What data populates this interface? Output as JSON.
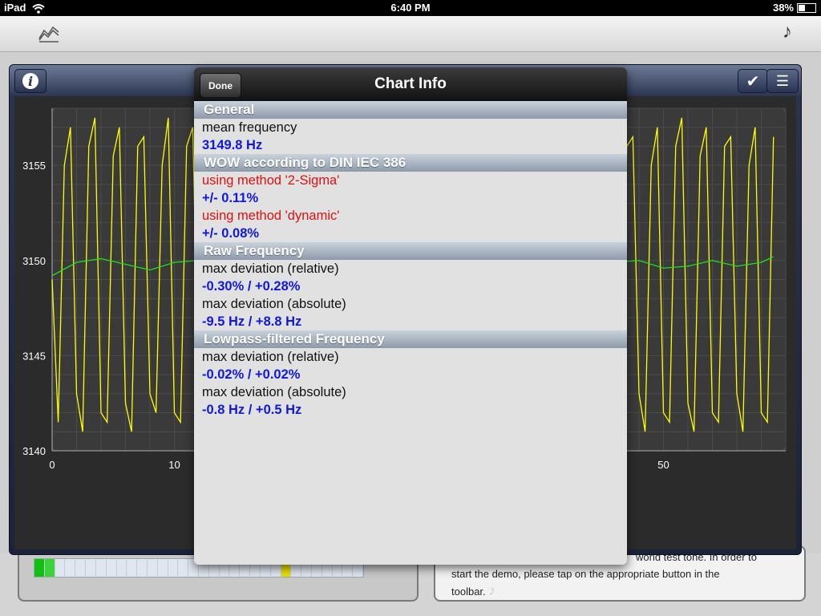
{
  "status_bar": {
    "device": "iPad",
    "time": "6:40 PM",
    "battery": "38%"
  },
  "chart": {
    "y_ticks": [
      "3155",
      "3150",
      "3145",
      "3140"
    ],
    "x_ticks": [
      "0",
      "10",
      "50"
    ]
  },
  "chart_data": {
    "type": "line",
    "ylim": [
      3140,
      3158
    ],
    "xlim": [
      0,
      60
    ],
    "y_ticks": [
      3140,
      3145,
      3150,
      3155
    ],
    "x_ticks": [
      0,
      10,
      50
    ],
    "grid": true,
    "series": [
      {
        "color": "#ffff00",
        "x": [
          0,
          0.5,
          1,
          1.5,
          2,
          2.5,
          3,
          3.5,
          4,
          4.5,
          5,
          5.5,
          6,
          6.5,
          7,
          7.5,
          8,
          8.5,
          9,
          9.5,
          10,
          10.5,
          11,
          11.5,
          12,
          12.5,
          13,
          13.5,
          14,
          14.5,
          15,
          15.5,
          16,
          16.5,
          17,
          17.5,
          18,
          18.5,
          19,
          19.5,
          20,
          20.5,
          21,
          21.5,
          22,
          22.5,
          23,
          23.5,
          24,
          24.5,
          25,
          25.5,
          26,
          26.5,
          27,
          27.5,
          28,
          28.5,
          29,
          29.5,
          30,
          30.5,
          31,
          31.5,
          32,
          32.5,
          33,
          33.5,
          34,
          34.5,
          35,
          35.5,
          36,
          36.5,
          37,
          37.5,
          38,
          38.5,
          39,
          39.5,
          40,
          40.5,
          41,
          41.5,
          42,
          42.5,
          43,
          43.5,
          44,
          44.5,
          45,
          45.5,
          46,
          46.5,
          47,
          47.5,
          48,
          48.5,
          49,
          49.5,
          50,
          50.5,
          51,
          51.5,
          52,
          52.5,
          53,
          53.5,
          54,
          54.5,
          55,
          55.5,
          56,
          56.5,
          57,
          57.5,
          58,
          58.5,
          59
        ],
        "y": [
          3149,
          3141.5,
          3155,
          3157,
          3143,
          3141,
          3156,
          3157.5,
          3142,
          3141.5,
          3155.5,
          3157,
          3142.5,
          3141,
          3156,
          3156.5,
          3143,
          3142,
          3155,
          3157.5,
          3142,
          3141.5,
          3156,
          3157,
          3142.5,
          3141,
          3155.5,
          3157,
          3142,
          3141.5,
          3156,
          3156.5,
          3143,
          3141,
          3155,
          3157,
          3142,
          3141.5,
          3156,
          3157.5,
          3142.5,
          3141,
          3155.5,
          3157,
          3142,
          3141.5,
          3156,
          3156.5,
          3143,
          3141,
          3155,
          3157.5,
          3142,
          3141.5,
          3156,
          3157,
          3142.5,
          3141,
          3155.5,
          3157,
          3142,
          3141.5,
          3156,
          3156.5,
          3143,
          3141,
          3155,
          3157,
          3142,
          3141.5,
          3156,
          3157.5,
          3142.5,
          3141,
          3155.5,
          3157,
          3142,
          3141.5,
          3156,
          3156.5,
          3143,
          3141,
          3155,
          3157,
          3142,
          3141.5,
          3156,
          3157.5,
          3142.5,
          3141,
          3155.5,
          3157,
          3142,
          3141.5,
          3156,
          3156.5,
          3143,
          3141,
          3155,
          3157,
          3142,
          3141.5,
          3156,
          3157.5,
          3142.5,
          3141,
          3155.5,
          3157,
          3142,
          3141.5,
          3156,
          3156.5,
          3143,
          3141,
          3155,
          3157,
          3142,
          3141.5,
          3156.5
        ]
      },
      {
        "color": "#20e020",
        "x": [
          0,
          2,
          4,
          6,
          8,
          10,
          12,
          14,
          16,
          18,
          20,
          22,
          24,
          26,
          28,
          30,
          32,
          34,
          36,
          38,
          40,
          42,
          44,
          46,
          48,
          50,
          52,
          54,
          56,
          58,
          59
        ],
        "y": [
          3149.2,
          3149.9,
          3150.1,
          3149.8,
          3149.5,
          3149.9,
          3150.0,
          3149.6,
          3149.7,
          3150.0,
          3149.8,
          3149.6,
          3149.9,
          3150.1,
          3149.7,
          3149.6,
          3150.0,
          3149.9,
          3149.6,
          3149.8,
          3150.1,
          3149.8,
          3149.5,
          3149.9,
          3150.0,
          3149.6,
          3149.7,
          3150.0,
          3149.7,
          3149.9,
          3150.2
        ]
      }
    ]
  },
  "popover": {
    "title": "Chart Info",
    "done_label": "Done",
    "sections": {
      "general": {
        "header": "General",
        "mean_label": "mean frequency",
        "mean_value": "3149.8 Hz"
      },
      "wow": {
        "header": "WOW according to DIN IEC 386",
        "method1_label": "using method '2-Sigma'",
        "method1_value": "+/- 0.11%",
        "method2_label": "using method 'dynamic'",
        "method2_value": "+/- 0.08%"
      },
      "raw": {
        "header": "Raw Frequency",
        "rel_label": "max deviation (relative)",
        "rel_value": "-0.30% / +0.28%",
        "abs_label": "max deviation (absolute)",
        "abs_value": "-9.5 Hz / +8.8 Hz"
      },
      "lowpass": {
        "header": "Lowpass-filtered Frequency",
        "rel_label": "max deviation (relative)",
        "rel_value": "-0.02% / +0.02%",
        "abs_label": "max deviation (absolute)",
        "abs_value": "-0.8 Hz / +0.5 Hz"
      }
    }
  },
  "info_panel": {
    "line1": "world test tone. In order to",
    "line2": "start the demo, please tap on the appropriate button in the",
    "line3": "toolbar."
  },
  "icons": {
    "chart_tab": "line-chart-icon",
    "music": "music-note-icon",
    "info": "info-icon",
    "check": "checkmark-icon",
    "list": "list-icon"
  }
}
